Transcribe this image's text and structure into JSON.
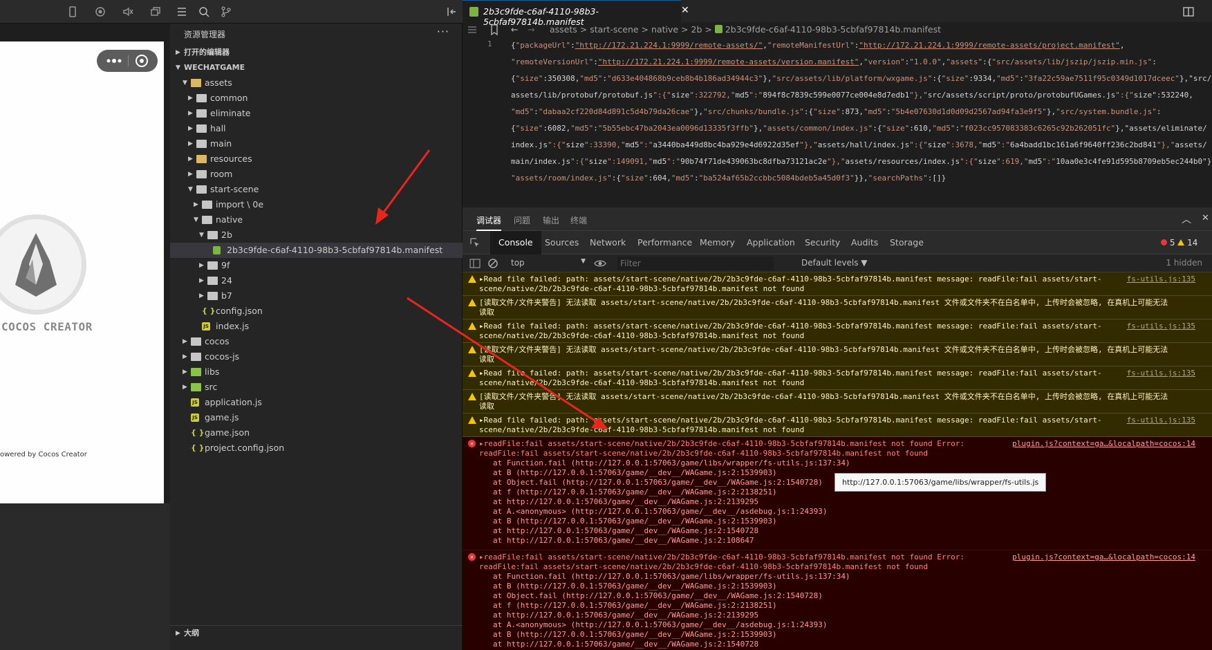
{
  "explorer": {
    "title": "资源管理器",
    "open_editors": "打开的编辑器",
    "workspace": "WECHATGAME",
    "outline": "大纲",
    "tree": [
      {
        "label": "assets",
        "kind": "folder-gold",
        "open": true
      },
      {
        "label": "common",
        "kind": "folder"
      },
      {
        "label": "eliminate",
        "kind": "folder"
      },
      {
        "label": "hall",
        "kind": "folder"
      },
      {
        "label": "main",
        "kind": "folder"
      },
      {
        "label": "resources",
        "kind": "folder-gold"
      },
      {
        "label": "room",
        "kind": "folder"
      },
      {
        "label": "start-scene",
        "kind": "folder",
        "open": true
      },
      {
        "label": "import \\ 0e",
        "kind": "folder"
      },
      {
        "label": "native",
        "kind": "folder",
        "open": true
      },
      {
        "label": "2b",
        "kind": "folder",
        "open": true
      },
      {
        "label": "2b3c9fde-c6af-4110-98b3-5cbfaf97814b.manifest",
        "kind": "manifest"
      },
      {
        "label": "9f",
        "kind": "folder"
      },
      {
        "label": "24",
        "kind": "folder"
      },
      {
        "label": "b7",
        "kind": "folder"
      },
      {
        "label": "config.json",
        "kind": "json"
      },
      {
        "label": "index.js",
        "kind": "js"
      },
      {
        "label": "cocos",
        "kind": "folder"
      },
      {
        "label": "cocos-js",
        "kind": "folder"
      },
      {
        "label": "libs",
        "kind": "folder-green"
      },
      {
        "label": "src",
        "kind": "folder-green"
      },
      {
        "label": "application.js",
        "kind": "js"
      },
      {
        "label": "game.js",
        "kind": "js"
      },
      {
        "label": "game.json",
        "kind": "json"
      },
      {
        "label": "project.config.json",
        "kind": "json"
      }
    ]
  },
  "simulator": {
    "brand": "COCOS CREATOR",
    "powered": "owered by Cocos Creator"
  },
  "editor": {
    "tab": "2b3c9fde-c6af-4110-98b3-5cbfaf97814b.manifest",
    "crumbs": [
      "assets",
      ">",
      "start-scene",
      ">",
      "native",
      ">",
      "2b",
      ">",
      "2b3c9fde-c6af-4110-98b3-5cbfaf97814b.manifest"
    ],
    "line_number": "1",
    "lines": [
      "{\"packageUrl\":\"http://172.21.224.1:9999/remote-assets/\",\"remoteManifestUrl\":\"http://172.21.224.1:9999/remote-assets/project.manifest\",",
      "\"remoteVersionUrl\":\"http://172.21.224.1:9999/remote-assets/version.manifest\",\"version\":\"1.0.0\",\"assets\":{\"src/assets/lib/jszip/jszip.min.js\":",
      "{\"size\":350308,\"md5\":\"d633e404868b9ceb8b4b186ad34944c3\"},\"src/assets/lib/platform/wxgame.js\":{\"size\":9334,\"md5\":\"3fa22c59ae7511f95c0349d1017dceec\"},\"src/",
      "assets/lib/protobuf/protobuf.js\":{\"size\":322792,\"md5\":\"894f8c7839c599e0077ce004e8d7edb1\"},\"src/assets/script/proto/protobufUGames.js\":{\"size\":532240,",
      "\"md5\":\"dabaa2cf220d84d891c5d4b79da26cae\"},\"src/chunks/bundle.js\":{\"size\":873,\"md5\":\"5b4e07630d1d0d09d2567ad94fa3e9f5\"},\"src/system.bundle.js\":",
      "{\"size\":6082,\"md5\":\"5b55ebc47ba2043ea0096d13335f3ffb\"},\"assets/common/index.js\":{\"size\":610,\"md5\":\"f023cc957083383c6265c92b262051fc\"},\"assets/eliminate/",
      "index.js\":{\"size\":33390,\"md5\":\"a3440ba449d8bc4ba929e4d6922d35ef\"},\"assets/hall/index.js\":{\"size\":3678,\"md5\":\"6a4badd1bc161a6f9640ff236c2bd841\"},\"assets/",
      "main/index.js\":{\"size\":149091,\"md5\":\"90b74f71de439063bc8dfba73121ac2e\"},\"assets/resources/index.js\":{\"size\":619,\"md5\":\"10aa0e3c4fe91d595b8709eb5ec244b0\"},",
      "\"assets/room/index.js\":{\"size\":604,\"md5\":\"ba524af65b2ccbbc5084bdeb5a45d0f3\"}},\"searchPaths\":[]}"
    ]
  },
  "devtools": {
    "top_tabs": [
      "调试器",
      "问题",
      "输出",
      "终端"
    ],
    "panels": [
      "Console",
      "Sources",
      "Network",
      "Performance",
      "Memory",
      "Application",
      "Security",
      "Audits",
      "Storage"
    ],
    "errors": "5",
    "warnings": "14",
    "context": "top",
    "filter_placeholder": "Filter",
    "levels": "Default levels ▼",
    "hidden": "1 hidden",
    "messages": [
      {
        "type": "warn",
        "text": "▸Read file failed: path: assets/start-scene/native/2b/2b3c9fde-c6af-4110-98b3-5cbfaf97814b.manifest message: readFile:fail assets/start-\nscene/native/2b/2b3c9fde-c6af-4110-98b3-5cbfaf97814b.manifest not found",
        "src": "fs-utils.js:135"
      },
      {
        "type": "warn",
        "text": "[读取文件/文件夹警告] 无法读取 assets/start-scene/native/2b/2b3c9fde-c6af-4110-98b3-5cbfaf97814b.manifest 文件或文件夹不在白名单中, 上传时会被忽略, 在真机上可能无法\n读取",
        "src": ""
      },
      {
        "type": "warn",
        "text": "▸Read file failed: path: assets/start-scene/native/2b/2b3c9fde-c6af-4110-98b3-5cbfaf97814b.manifest message: readFile:fail assets/start-\nscene/native/2b/2b3c9fde-c6af-4110-98b3-5cbfaf97814b.manifest not found",
        "src": "fs-utils.js:135"
      },
      {
        "type": "warn",
        "text": "[读取文件/文件夹警告] 无法读取 assets/start-scene/native/2b/2b3c9fde-c6af-4110-98b3-5cbfaf97814b.manifest 文件或文件夹不在白名单中, 上传时会被忽略, 在真机上可能无法\n读取",
        "src": ""
      },
      {
        "type": "warn",
        "text": "▸Read file failed: path: assets/start-scene/native/2b/2b3c9fde-c6af-4110-98b3-5cbfaf97814b.manifest message: readFile:fail assets/start-\nscene/native/2b/2b3c9fde-c6af-4110-98b3-5cbfaf97814b.manifest not found",
        "src": "fs-utils.js:135"
      },
      {
        "type": "warn",
        "text": "[读取文件/文件夹警告] 无法读取 assets/start-scene/native/2b/2b3c9fde-c6af-4110-98b3-5cbfaf97814b.manifest 文件或文件夹不在白名单中, 上传时会被忽略, 在真机上可能无法\n读取",
        "src": ""
      },
      {
        "type": "warn",
        "text": "▸Read file failed: path: assets/start-scene/native/2b/2b3c9fde-c6af-4110-98b3-5cbfaf97814b.manifest message: readFile:fail assets/start-\nscene/native/2b/2b3c9fde-c6af-4110-98b3-5cbfaf97814b.manifest not found",
        "src": "fs-utils.js:135"
      },
      {
        "type": "err",
        "text": "▸readFile:fail assets/start-scene/native/2b/2b3c9fde-c6af-4110-98b3-5cbfaf97814b.manifest not found Error:\nreadFile:fail assets/start-scene/native/2b/2b3c9fde-c6af-4110-98b3-5cbfaf97814b.manifest not found",
        "src": "plugin.js?context=ga…&localpath=cocos:14",
        "stack": [
          "at Function.fail (http://127.0.0.1:57063/game/libs/wrapper/fs-utils.js:137:34)",
          "at B (http://127.0.0.1:57063/game/__dev__/WAGame.js:2:1539903)",
          "at Object.fail (http://127.0.0.1:57063/game/__dev__/WAGame.js:2:1540728)",
          "at f (http://127.0.0.1:57063/game/__dev__/WAGame.js:2:2138251)",
          "at http://127.0.0.1:57063/game/__dev__/WAGame.js:2:2139295",
          "at A.<anonymous> (http://127.0.0.1:57063/game/__dev__/asdebug.js:1:24393)",
          "at B (http://127.0.0.1:57063/game/__dev__/WAGame.js:2:1539903)",
          "at http://127.0.0.1:57063/game/__dev__/WAGame.js:2:1540728",
          "at http://127.0.0.1:57063/game/__dev__/WAGame.js:2:108647"
        ]
      },
      {
        "type": "err",
        "text": "▸readFile:fail assets/start-scene/native/2b/2b3c9fde-c6af-4110-98b3-5cbfaf97814b.manifest not found Error:\nreadFile:fail assets/start-scene/native/2b/2b3c9fde-c6af-4110-98b3-5cbfaf97814b.manifest not found",
        "src": "plugin.js?context=ga…&localpath=cocos:14",
        "stack": [
          "at Function.fail (http://127.0.0.1:57063/game/libs/wrapper/fs-utils.js:137:34)",
          "at B (http://127.0.0.1:57063/game/__dev__/WAGame.js:2:1539903)",
          "at Object.fail (http://127.0.0.1:57063/game/__dev__/WAGame.js:2:1540728)",
          "at f (http://127.0.0.1:57063/game/__dev__/WAGame.js:2:2138251)",
          "at http://127.0.0.1:57063/game/__dev__/WAGame.js:2:2139295",
          "at A.<anonymous> (http://127.0.0.1:57063/game/__dev__/asdebug.js:1:24393)",
          "at B (http://127.0.0.1:57063/game/__dev__/WAGame.js:2:1539903)",
          "at http://127.0.0.1:57063/game/__dev__/WAGame.js:2:1540728"
        ]
      }
    ],
    "tooltip": "http://127.0.0.1:57063/game/libs/wrapper/fs-utils.js"
  },
  "colors": {
    "annotation_arrow": "#e8261c"
  }
}
